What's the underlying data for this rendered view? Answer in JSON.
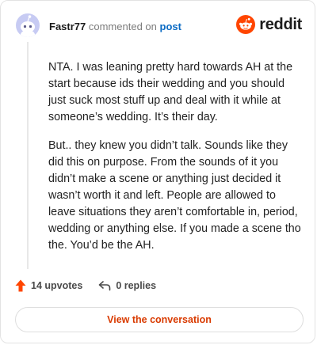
{
  "header": {
    "username": "Fastr77",
    "action_text": "commented on",
    "post_link": "post",
    "logo_text": "reddit"
  },
  "colors": {
    "reddit_orange": "#ff4500",
    "link_blue": "#0b6bc4",
    "button_text": "#d93a00",
    "avatar_bg": "#c7cbf3"
  },
  "icons": {
    "avatar": "snoo-avatar-icon",
    "logo": "reddit-snoo-logo-icon",
    "upvote": "upvote-arrow-icon",
    "replies": "reply-arrow-icon"
  },
  "comment": {
    "paragraphs": [
      "NTA. I was leaning pretty hard towards AH at the start because ids their wedding and you should just suck most stuff up and deal with it while at someone’s wedding. It’s their day.",
      "But.. they knew you didn’t talk. Sounds like they did this on purpose. From the sounds of it you didn’t make a scene or anything just decided it wasn’t worth it and left. People are allowed to leave situations they aren’t comfortable in, period, wedding or anything else. If you made a scene tho the. You’d be the AH."
    ]
  },
  "meta": {
    "upvotes": "14 upvotes",
    "replies": "0 replies"
  },
  "footer": {
    "button_label": "View the conversation"
  }
}
